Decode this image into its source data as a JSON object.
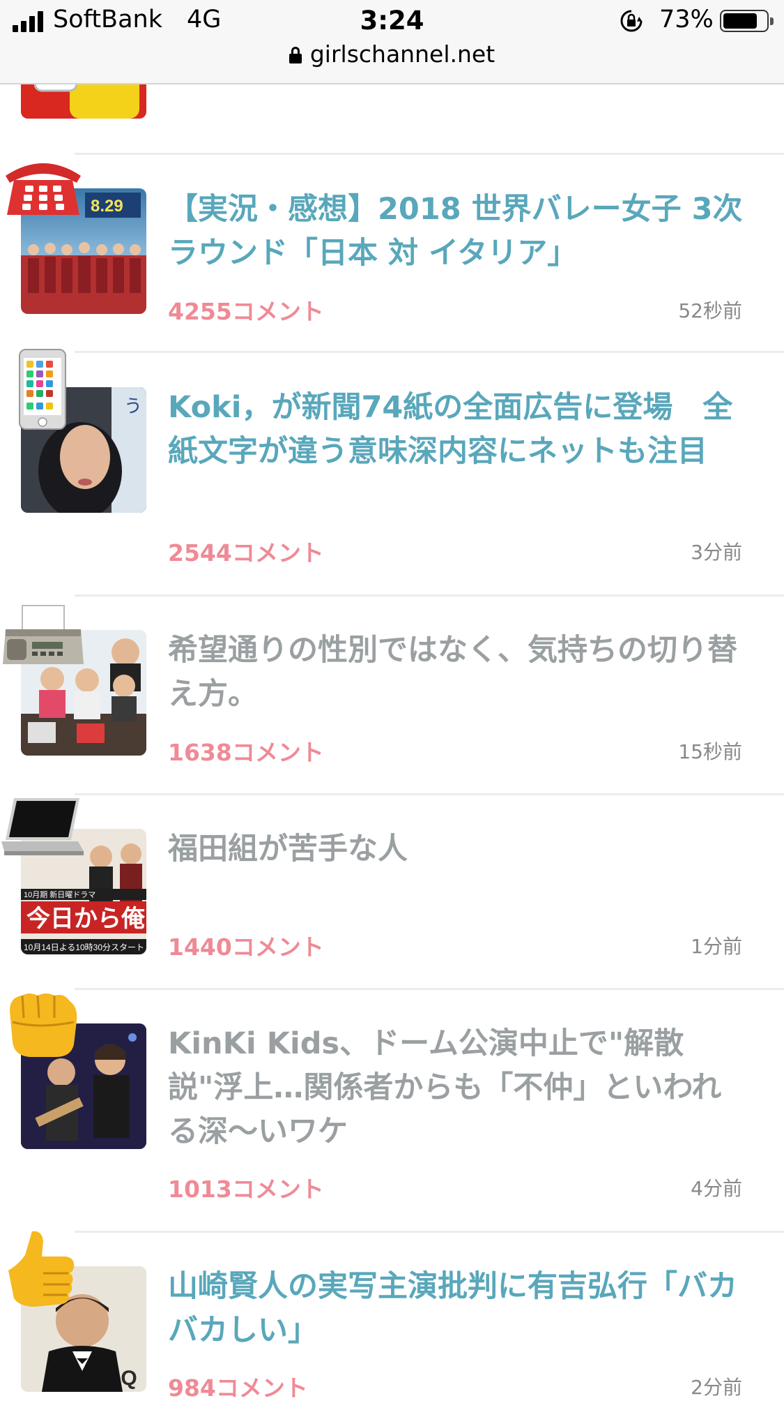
{
  "status_bar": {
    "carrier": "SoftBank",
    "network": "4G",
    "time": "3:24",
    "battery_percent": "73%",
    "battery_level": 0.73,
    "url": "girlschannel.net"
  },
  "topics": [
    {
      "title": "【実況・感想】2018 世界バレー女子 3次ラウンド「日本 対 イタリア」",
      "comments": "4255コメント",
      "time": "52秒前",
      "state": "new",
      "emoji_icon": "telephone-icon"
    },
    {
      "title": "Koki，が新聞74紙の全面広告に登場　全紙文字が違う意味深内容にネットも注目",
      "comments": "2544コメント",
      "time": "3分前",
      "state": "new",
      "emoji_icon": "mobile-phone-icon"
    },
    {
      "title": "希望通りの性別ではなく、気持ちの切り替え方。",
      "comments": "1638コメント",
      "time": "15秒前",
      "state": "read",
      "emoji_icon": "fax-machine-icon"
    },
    {
      "title": "福田組が苦手な人",
      "comments": "1440コメント",
      "time": "1分前",
      "state": "read",
      "emoji_icon": "laptop-icon"
    },
    {
      "title": "KinKi Kids、ドーム公演中止で\"解散説\"浮上…関係者からも「不仲」といわれる深〜いワケ",
      "comments": "1013コメント",
      "time": "4分前",
      "state": "read",
      "emoji_icon": "fist-icon"
    },
    {
      "title": "山崎賢人の実写主演批判に有吉弘行「バカバカしい」",
      "comments": "984コメント",
      "time": "2分前",
      "state": "new",
      "emoji_icon": "thumbs-up-icon"
    }
  ],
  "colors": {
    "title_new": "#59a7bb",
    "title_read": "#9aa0a2",
    "comment_count": "#ef8a96",
    "timestamp": "#888888"
  }
}
